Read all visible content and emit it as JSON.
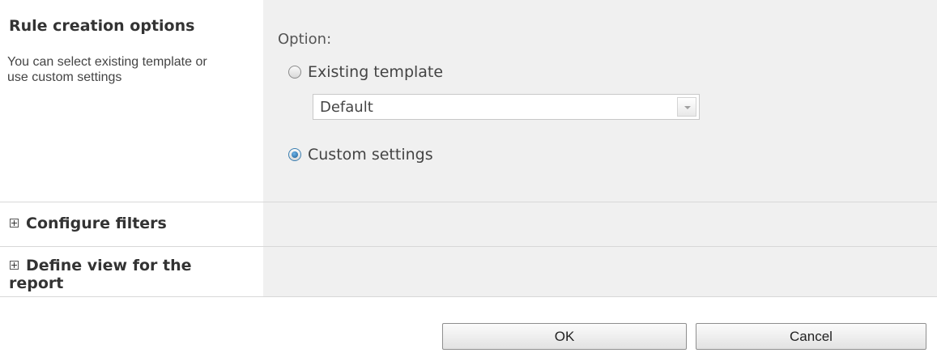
{
  "rule_creation": {
    "title": "Rule creation options",
    "description": "You can select existing template or use custom settings",
    "option_label": "Option:",
    "existing_template_label": "Existing template",
    "existing_template_selected": false,
    "template_select_value": "Default",
    "custom_settings_label": "Custom settings",
    "custom_settings_selected": true
  },
  "configure_filters": {
    "title": "Configure filters",
    "icon": "expand-plus-icon"
  },
  "define_view": {
    "title": "Define view for the report",
    "icon": "expand-plus-icon"
  },
  "buttons": {
    "ok_label": "OK",
    "cancel_label": "Cancel"
  },
  "colors": {
    "panel_background": "#f0f0f0",
    "radio_selected": "#1c5d94"
  }
}
